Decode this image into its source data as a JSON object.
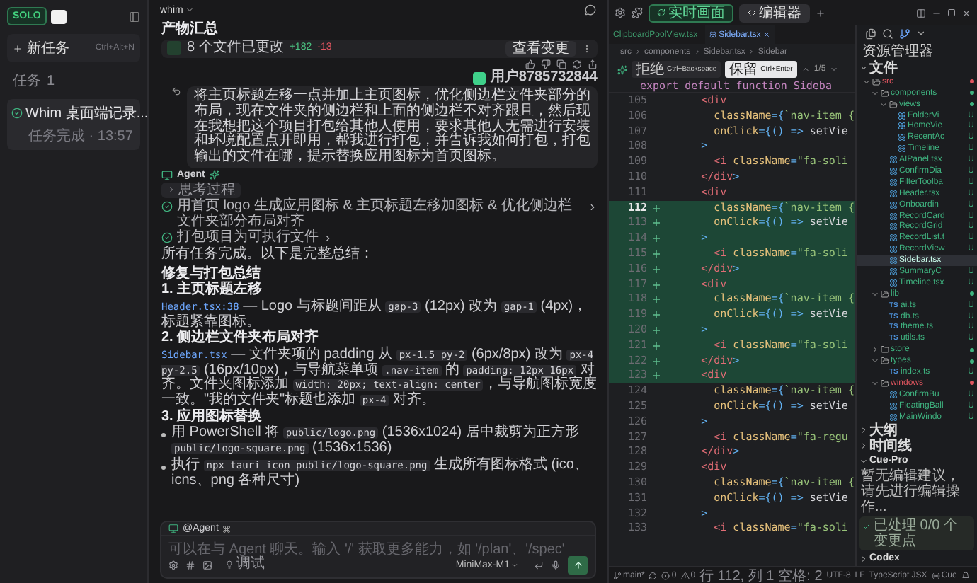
{
  "sidebar": {
    "logo": "SOLO",
    "new_task": {
      "label": "新任务",
      "shortcut": "Ctrl+Alt+N"
    },
    "section": {
      "label": "任务",
      "count": "1"
    },
    "tasks": [
      {
        "title": "Whim 桌面端记录...",
        "status": "任务完成 · 13:57",
        "done": true,
        "selected": true
      }
    ]
  },
  "chat": {
    "project": "whim",
    "artifacts": {
      "title": "产物汇总",
      "files_changed": "8 个文件已更改",
      "added": "+182",
      "removed": "-13",
      "view_button": "查看变更"
    },
    "user": {
      "name": "用户8785732844",
      "message": "将主页标题左移一点并加上主页图标，优化侧边栏文件夹部分的布局，现在文件夹的侧边栏和上面的侧边栏不对齐跟且，然后现在我想把这个项目打包给其他人使用，要求其他人无需进行安装和环境配置点开即用，帮我进行打包，并告诉我如何打包，打包输出的文件在哪，提示替换应用图标为首页图标。"
    },
    "agent": {
      "name": "Agent",
      "thinking": {
        "label": "思考过程",
        "expanded": false
      },
      "steps": [
        {
          "text": "用首页 logo 生成应用图标 & 主页标题左移加图标 & 优化侧边栏文件夹部分布局对齐",
          "done": true
        },
        {
          "text": "打包项目为可执行文件",
          "done": true
        }
      ],
      "intro": "所有任务完成。以下是完整总结：",
      "summary_title": "修复与打包总结",
      "sections": [
        {
          "heading": "1. 主页标题左移",
          "blocks": [
            {
              "kind": "paragraph",
              "parts": [
                {
                  "kind": "link",
                  "text": "Header.tsx:38"
                },
                {
                  "kind": "text",
                  "text": " — Logo 与标题间距从 "
                },
                {
                  "kind": "code",
                  "text": "gap-3"
                },
                {
                  "kind": "text",
                  "text": " (12px) 改为 "
                },
                {
                  "kind": "code",
                  "text": "gap-1"
                },
                {
                  "kind": "text",
                  "text": " (4px)，标题紧靠图标。"
                }
              ]
            }
          ]
        },
        {
          "heading": "2. 侧边栏文件夹布局对齐",
          "blocks": [
            {
              "kind": "paragraph",
              "parts": [
                {
                  "kind": "link",
                  "text": "Sidebar.tsx"
                },
                {
                  "kind": "text",
                  "text": " — 文件夹项的 padding 从 "
                },
                {
                  "kind": "code",
                  "text": "px-1.5 py-2"
                },
                {
                  "kind": "text",
                  "text": " (6px/8px) 改为 "
                },
                {
                  "kind": "code",
                  "text": "px-4 py-2.5"
                },
                {
                  "kind": "text",
                  "text": " (16px/10px)，与导航菜单项 "
                },
                {
                  "kind": "code",
                  "text": ".nav-item"
                },
                {
                  "kind": "text",
                  "text": " 的 "
                },
                {
                  "kind": "code",
                  "text": "padding: 12px 16px"
                },
                {
                  "kind": "text",
                  "text": " 对齐。文件夹图标添加 "
                },
                {
                  "kind": "code",
                  "text": "width: 20px; text-align: center"
                },
                {
                  "kind": "text",
                  "text": "，与导航图标宽度一致。\"我的文件夹\"标题也添加 "
                },
                {
                  "kind": "code",
                  "text": "px-4"
                },
                {
                  "kind": "text",
                  "text": " 对齐。"
                }
              ]
            }
          ]
        },
        {
          "heading": "3. 应用图标替换",
          "blocks": [
            {
              "kind": "bullet",
              "parts": [
                {
                  "kind": "text",
                  "text": "用 PowerShell 将 "
                },
                {
                  "kind": "code",
                  "text": "public/logo.png"
                },
                {
                  "kind": "text",
                  "text": " (1536x1024) 居中裁剪为正方形 "
                },
                {
                  "kind": "code",
                  "text": "public/logo-square.png"
                },
                {
                  "kind": "text",
                  "text": " (1536x1536)"
                }
              ]
            },
            {
              "kind": "bullet",
              "parts": [
                {
                  "kind": "text",
                  "text": "执行 "
                },
                {
                  "kind": "code",
                  "text": "npx tauri icon public/logo-square.png"
                },
                {
                  "kind": "text",
                  "text": " 生成所有图标格式 (ico、icns、png 各种尺寸)"
                }
              ]
            }
          ]
        }
      ]
    },
    "input": {
      "mention": "@Agent",
      "placeholder": "可以在与 Agent 聊天。输入 '/' 获取更多能力，如 '/plan'、'/spec'",
      "mode": "调试",
      "model": "MiniMax-M1"
    }
  },
  "top_tabs": [
    {
      "label": "实时画面",
      "kind": "live",
      "selected": false
    },
    {
      "label": "编辑器",
      "kind": "code",
      "selected": true
    }
  ],
  "editor": {
    "tabs": [
      {
        "label": "ClipboardPoolView.tsx",
        "selected": false
      },
      {
        "label": "Sidebar.tsx",
        "selected": true
      }
    ],
    "breadcrumb": [
      "src",
      "components",
      "Sidebar.tsx",
      "Sidebar"
    ],
    "diff": {
      "reject": "拒绝",
      "reject_key": "Ctrl+Backspace",
      "keep": "保留",
      "keep_key": "Ctrl+Enter",
      "position": "1/5"
    },
    "sticky": "export default function Sideba",
    "lines": [
      {
        "no": "105",
        "code": "      <div",
        "added": false,
        "current": false
      },
      {
        "no": "106",
        "code": "        className={`nav-item {",
        "added": false,
        "current": false
      },
      {
        "no": "107",
        "code": "        onClick={() => setVie",
        "added": false,
        "current": false
      },
      {
        "no": "108",
        "code": "      >",
        "added": false,
        "current": false
      },
      {
        "no": "109",
        "code": "        <i className=\"fa-soli",
        "added": false,
        "current": false
      },
      {
        "no": "110",
        "code": "      </div>",
        "added": false,
        "current": false
      },
      {
        "no": "111",
        "code": "      <div",
        "added": false,
        "current": false
      },
      {
        "no": "112",
        "code": "        className={`nav-item {",
        "added": true,
        "current": true
      },
      {
        "no": "113",
        "code": "        onClick={() => setVie",
        "added": true,
        "current": false
      },
      {
        "no": "114",
        "code": "      >",
        "added": true,
        "current": false
      },
      {
        "no": "115",
        "code": "        <i className=\"fa-soli",
        "added": true,
        "current": false
      },
      {
        "no": "116",
        "code": "      </div>",
        "added": true,
        "current": false
      },
      {
        "no": "117",
        "code": "      <div",
        "added": true,
        "current": false
      },
      {
        "no": "118",
        "code": "        className={`nav-item {",
        "added": true,
        "current": false
      },
      {
        "no": "119",
        "code": "        onClick={() => setVie",
        "added": true,
        "current": false
      },
      {
        "no": "120",
        "code": "      >",
        "added": true,
        "current": false
      },
      {
        "no": "121",
        "code": "        <i className=\"fa-soli",
        "added": true,
        "current": false
      },
      {
        "no": "122",
        "code": "      </div>",
        "added": true,
        "current": false
      },
      {
        "no": "123",
        "code": "      <div",
        "added": true,
        "current": false
      },
      {
        "no": "124",
        "code": "        className={`nav-item {",
        "added": false,
        "current": false
      },
      {
        "no": "125",
        "code": "        onClick={() => setVie",
        "added": false,
        "current": false
      },
      {
        "no": "126",
        "code": "      >",
        "added": false,
        "current": false
      },
      {
        "no": "127",
        "code": "        <i className=\"fa-regu",
        "added": false,
        "current": false
      },
      {
        "no": "128",
        "code": "      </div>",
        "added": false,
        "current": false
      },
      {
        "no": "129",
        "code": "      <div",
        "added": false,
        "current": false
      },
      {
        "no": "130",
        "code": "        className={`nav-item {",
        "added": false,
        "current": false
      },
      {
        "no": "131",
        "code": "        onClick={() => setVie",
        "added": false,
        "current": false
      },
      {
        "no": "132",
        "code": "      >",
        "added": false,
        "current": false
      },
      {
        "no": "133",
        "code": "        <i className=\"fa-soli",
        "added": false,
        "current": false
      }
    ]
  },
  "explorer": {
    "title": "资源管理器",
    "section": "文件",
    "tree": [
      {
        "name": "src",
        "kind": "folder",
        "expanded": true,
        "selected": false,
        "color": "#e0555f",
        "children": [
          {
            "name": "components",
            "kind": "folder",
            "expanded": true,
            "selected": false,
            "color": "#3fb27f",
            "children": [
              {
                "name": "views",
                "kind": "folder",
                "expanded": true,
                "selected": false,
                "color": "#3fb27f",
                "children": [
                  {
                    "name": "FolderVi",
                    "kind": "react",
                    "badge": "U",
                    "selected": false
                  },
                  {
                    "name": "HomeVie",
                    "kind": "react",
                    "badge": "U",
                    "selected": false
                  },
                  {
                    "name": "RecentAc",
                    "kind": "react",
                    "badge": "U",
                    "selected": false
                  },
                  {
                    "name": "Timeline",
                    "kind": "react",
                    "badge": "U",
                    "selected": false
                  }
                ]
              },
              {
                "name": "AIPanel.tsx",
                "kind": "react",
                "badge": "U",
                "selected": false
              },
              {
                "name": "ConfirmDia",
                "kind": "react",
                "badge": "U",
                "selected": false
              },
              {
                "name": "FilterToolba",
                "kind": "react",
                "badge": "U",
                "selected": false
              },
              {
                "name": "Header.tsx",
                "kind": "react",
                "badge": "U",
                "selected": false
              },
              {
                "name": "Onboardin",
                "kind": "react",
                "badge": "U",
                "selected": false
              },
              {
                "name": "RecordCard",
                "kind": "react",
                "badge": "U",
                "selected": false
              },
              {
                "name": "RecordGrid",
                "kind": "react",
                "badge": "U",
                "selected": false
              },
              {
                "name": "RecordList.t",
                "kind": "react",
                "badge": "U",
                "selected": false
              },
              {
                "name": "RecordView",
                "kind": "react",
                "badge": "U",
                "selected": false
              },
              {
                "name": "Sidebar.tsx",
                "kind": "react",
                "selected": true
              },
              {
                "name": "SummaryC",
                "kind": "react",
                "badge": "U",
                "selected": false
              },
              {
                "name": "Timeline.tsx",
                "kind": "react",
                "badge": "U",
                "selected": false
              }
            ]
          },
          {
            "name": "lib",
            "kind": "folder",
            "expanded": true,
            "selected": false,
            "color": "#3fb27f",
            "children": [
              {
                "name": "ai.ts",
                "kind": "ts",
                "tag": "TS",
                "badge": "U",
                "selected": false
              },
              {
                "name": "db.ts",
                "kind": "ts",
                "tag": "TS",
                "badge": "U",
                "selected": false
              },
              {
                "name": "theme.ts",
                "kind": "ts",
                "tag": "TS",
                "badge": "U",
                "selected": false
              },
              {
                "name": "utils.ts",
                "kind": "ts",
                "tag": "TS",
                "badge": "U",
                "selected": false
              }
            ]
          },
          {
            "name": "store",
            "kind": "folder",
            "expanded": false,
            "selected": false,
            "color": "#3fb27f"
          },
          {
            "name": "types",
            "kind": "folder",
            "expanded": true,
            "selected": false,
            "color": "#3fb27f",
            "children": [
              {
                "name": "index.ts",
                "kind": "ts",
                "tag": "TS",
                "badge": "U",
                "selected": false
              }
            ]
          },
          {
            "name": "windows",
            "kind": "folder",
            "expanded": true,
            "selected": false,
            "color": "#e0555f",
            "children": [
              {
                "name": "ConfirmBu",
                "kind": "react",
                "badge": "U",
                "selected": false
              },
              {
                "name": "FloatingBall",
                "kind": "react",
                "badge": "U",
                "selected": false
              },
              {
                "name": "MainWindo",
                "kind": "react",
                "badge": "U",
                "selected": false
              }
            ]
          }
        ]
      }
    ],
    "panels": [
      {
        "title": "大纲",
        "expanded": false
      },
      {
        "title": "时间线",
        "expanded": false
      }
    ],
    "cue": {
      "title": "Cue-Pro",
      "expanded": true,
      "message": "暂无编辑建议，请先进行编辑操作...",
      "status": "已处理 0/0 个变更点"
    },
    "codex": {
      "title": "Codex",
      "expanded": false
    }
  },
  "status_bar": [
    {
      "kind": "branch",
      "text": "main*"
    },
    {
      "kind": "sync"
    },
    {
      "kind": "errors",
      "text": "0"
    },
    {
      "kind": "warnings",
      "text": "0"
    },
    {
      "kind": "text",
      "text": "行 112, 列 1"
    },
    {
      "kind": "text",
      "text": "空格: 2"
    },
    {
      "kind": "text",
      "text": "UTF-8"
    },
    {
      "kind": "text",
      "text": "LF"
    },
    {
      "kind": "text",
      "text": "TypeScript JSX"
    },
    {
      "kind": "cue",
      "text": "Cue"
    }
  ]
}
